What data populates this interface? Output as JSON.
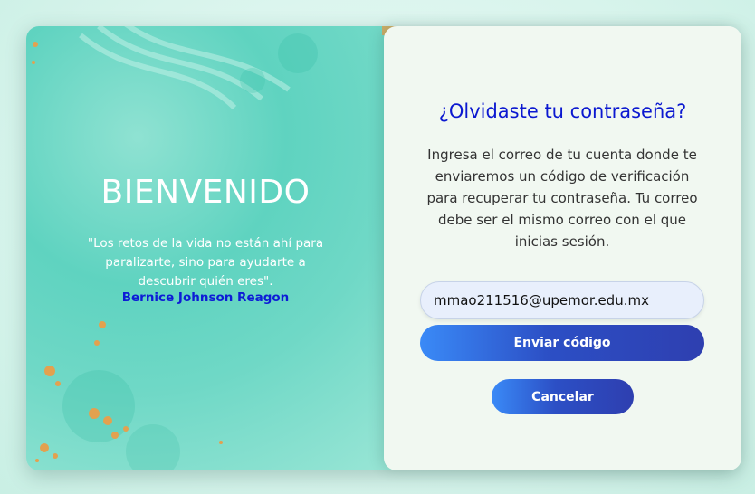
{
  "welcome": {
    "title": "BIENVENIDO",
    "quote": "\"Los retos de la vida no están ahí para paralizarte, sino para ayudarte a descubrir quién eres\".",
    "author": "Bernice Johnson Reagon"
  },
  "form": {
    "heading": "¿Olvidaste tu contraseña?",
    "description": "Ingresa el correo de tu cuenta donde te enviaremos un código de verificación para recuperar tu contraseña. Tu correo debe ser el mismo correo con el que inicias sesión.",
    "email_value": "mmao211516@upemor.edu.mx",
    "send_label": "Enviar código",
    "cancel_label": "Cancelar"
  },
  "colors": {
    "accent_blue": "#0b18d0",
    "button_gradient_start": "#3a8af7",
    "button_gradient_end": "#2e3fb0",
    "panel_teal": "#5fd3c0",
    "panel_light": "#f1f8f1",
    "splash_gold": "#e3a14f"
  }
}
